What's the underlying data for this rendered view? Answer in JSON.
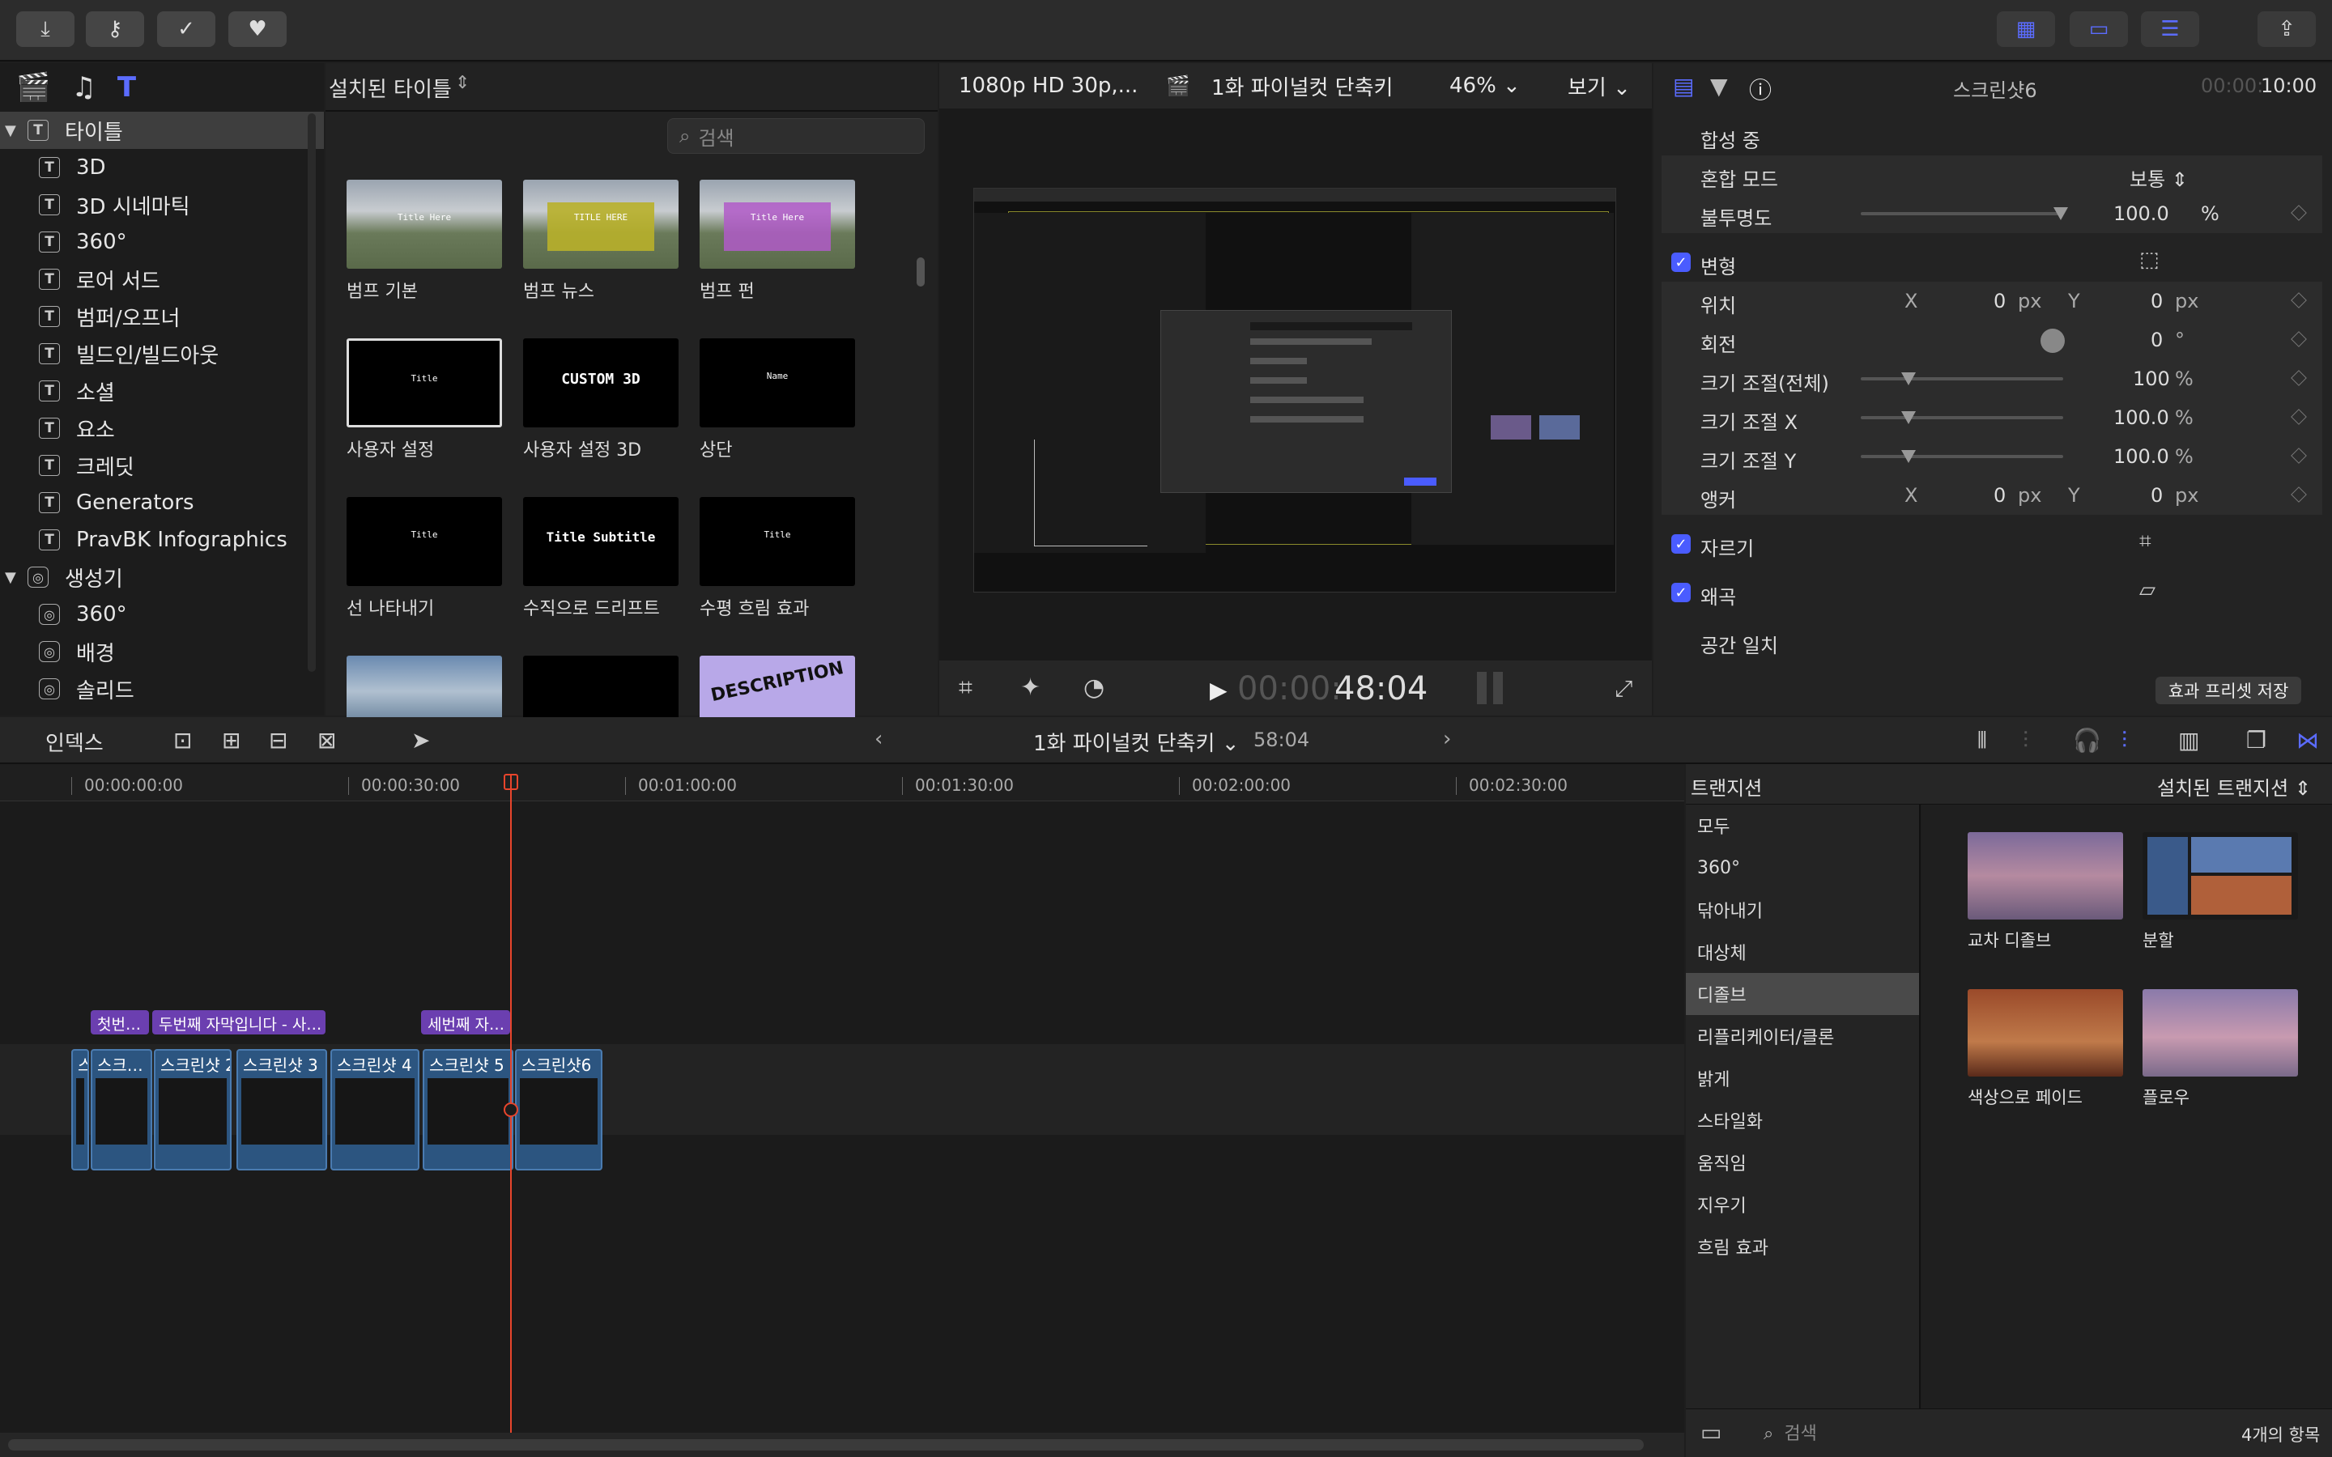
{
  "toolbar": {
    "left_icons": [
      "import-icon",
      "keyword-icon",
      "check-icon",
      "heart-icon"
    ],
    "right_icons": [
      "grid-view-icon",
      "filmstrip-view-icon",
      "sliders-icon",
      "share-icon"
    ]
  },
  "library": {
    "tabs": [
      "clapper-icon",
      "music-icon",
      "titles-icon"
    ],
    "tree": [
      {
        "label": "타이틀",
        "type": "group",
        "icon": "T",
        "selected": true
      },
      {
        "label": "3D",
        "type": "item",
        "icon": "T"
      },
      {
        "label": "3D 시네마틱",
        "type": "item",
        "icon": "T"
      },
      {
        "label": "360°",
        "type": "item",
        "icon": "T"
      },
      {
        "label": "로어 서드",
        "type": "item",
        "icon": "T"
      },
      {
        "label": "범퍼/오프너",
        "type": "item",
        "icon": "T"
      },
      {
        "label": "빌드인/빌드아웃",
        "type": "item",
        "icon": "T"
      },
      {
        "label": "소셜",
        "type": "item",
        "icon": "T"
      },
      {
        "label": "요소",
        "type": "item",
        "icon": "T"
      },
      {
        "label": "크레딧",
        "type": "item",
        "icon": "T"
      },
      {
        "label": "Generators",
        "type": "item",
        "icon": "T"
      },
      {
        "label": "PravBK Infographics",
        "type": "item",
        "icon": "T"
      },
      {
        "label": "생성기",
        "type": "group",
        "icon": "G"
      },
      {
        "label": "360°",
        "type": "item",
        "icon": "G"
      },
      {
        "label": "배경",
        "type": "item",
        "icon": "G"
      },
      {
        "label": "솔리드",
        "type": "item",
        "icon": "G"
      }
    ]
  },
  "browser": {
    "header": "설치된 타이틀",
    "search_placeholder": "검색",
    "items": [
      {
        "label": "범프 기본",
        "thumb_text": "Title Here",
        "style": "mountain-gray"
      },
      {
        "label": "범프 뉴스",
        "thumb_text": "TITLE HERE",
        "style": "mountain-yellow"
      },
      {
        "label": "범프 펀",
        "thumb_text": "Title Here",
        "style": "mountain-purple"
      },
      {
        "label": "사용자 설정",
        "thumb_text": "Title",
        "style": "black-selected"
      },
      {
        "label": "사용자 설정 3D",
        "thumb_text": "CUSTOM 3D",
        "style": "black"
      },
      {
        "label": "상단",
        "thumb_text": "Name",
        "style": "black"
      },
      {
        "label": "선 나타내기",
        "thumb_text": "Title",
        "style": "black"
      },
      {
        "label": "수직으로 드리프트",
        "thumb_text": "Title Subtitle",
        "style": "black"
      },
      {
        "label": "수평 흐림 효과",
        "thumb_text": "Title",
        "style": "black"
      },
      {
        "label": "",
        "thumb_text": "",
        "style": "mountain-blue"
      },
      {
        "label": "",
        "thumb_text": "",
        "style": "black"
      },
      {
        "label": "",
        "thumb_text": "DESCRIPTION",
        "style": "purple-text"
      }
    ]
  },
  "viewer": {
    "format": "1080p HD 30p,...",
    "project": "1화 파이널컷 단축키",
    "zoom": "46%",
    "view_label": "보기",
    "timecode_dim": "00:00:",
    "timecode": "48:04"
  },
  "inspector": {
    "title": "스크린샷6",
    "duration_dim": "00:00:",
    "duration": "10:00",
    "compositing": "합성 중",
    "blend_label": "혼합 모드",
    "blend_value": "보통",
    "opacity_label": "불투명도",
    "opacity_value": "100.0",
    "opacity_fraction": 1.0,
    "transform": "변형",
    "position_label": "위치",
    "position_x": "0",
    "position_y": "0",
    "rotation_label": "회전",
    "rotation_value": "0",
    "scale_all_label": "크기 조절(전체)",
    "scale_all_value": "100",
    "scale_x_label": "크기 조절 X",
    "scale_x_value": "100.0",
    "scale_y_label": "크기 조절 Y",
    "scale_y_value": "100.0",
    "anchor_label": "앵커",
    "anchor_x": "0",
    "anchor_y": "0",
    "crop": "자르기",
    "distort": "왜곡",
    "spatial": "공간 일치",
    "save_preset": "효과 프리셋 저장",
    "unit_px": "px",
    "unit_pct": "%",
    "unit_deg": "°",
    "axis_x": "X",
    "axis_y": "Y"
  },
  "timeline_bar": {
    "index": "인덱스",
    "project": "1화 파이널컷 단축키",
    "duration": "58:04"
  },
  "ruler": [
    "00:00:00:00",
    "00:00:30:00",
    "00:01:00:00",
    "00:01:30:00",
    "00:02:00:00",
    "00:02:30:00"
  ],
  "title_clips": [
    "첫번…",
    "두번째 자막입니다 - 사…",
    "세번째 자…"
  ],
  "clips": [
    "스",
    "스크…",
    "스크린샷 2",
    "스크린샷 3",
    "스크린샷 4",
    "스크린샷 5",
    "스크린샷6"
  ],
  "transitions": {
    "header": "트랜지션",
    "installed": "설치된 트랜지션",
    "categories": [
      "모두",
      "360°",
      "닦아내기",
      "대상체",
      "디졸브",
      "리플리케이터/클론",
      "밝게",
      "스타일화",
      "움직임",
      "지우기",
      "흐림 효과"
    ],
    "selected": "디졸브",
    "items": [
      {
        "label": "교차 디졸브"
      },
      {
        "label": "분할"
      },
      {
        "label": "색상으로 페이드"
      },
      {
        "label": "플로우"
      }
    ],
    "search_placeholder": "검색",
    "count": "4개의 항목"
  }
}
